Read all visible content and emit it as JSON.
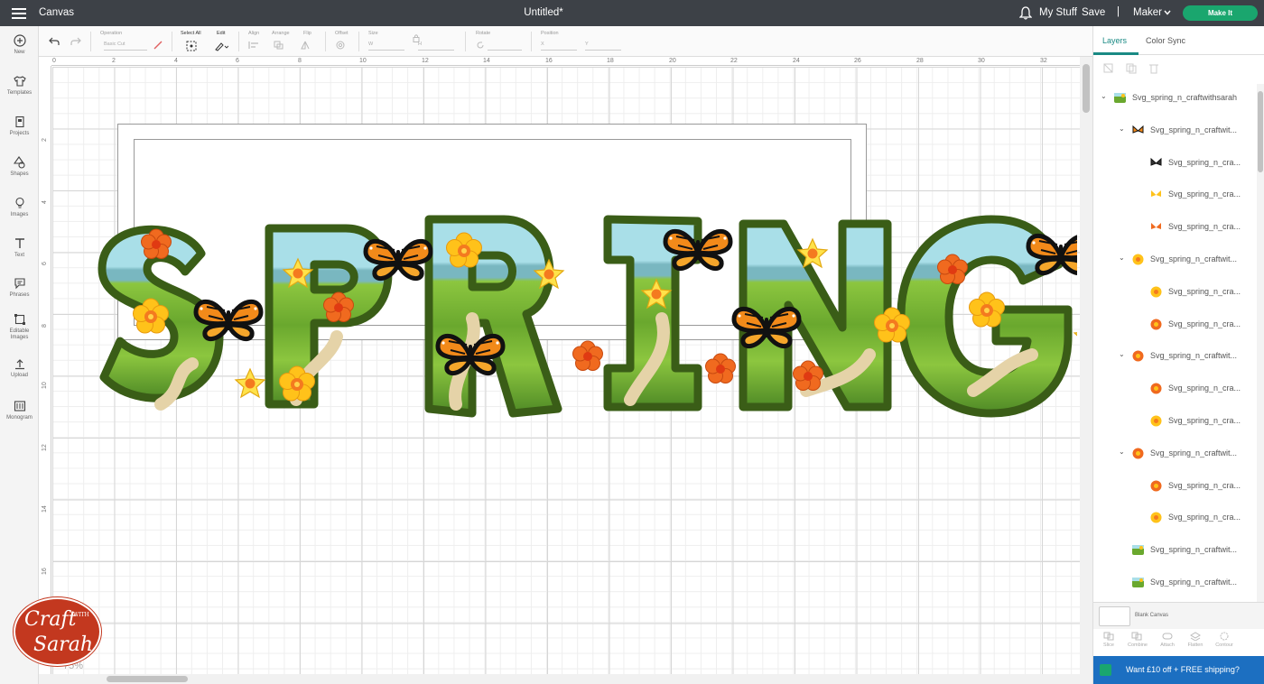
{
  "topbar": {
    "app_title": "Canvas",
    "document_title": "Untitled*",
    "my_stuff": "My Stuff",
    "save": "Save",
    "separator": "|",
    "machine": "Maker",
    "make_it": "Make It",
    "accent_color": "#1aa66e"
  },
  "sidebar": {
    "items": [
      {
        "label": "New",
        "icon": "plus-circle-icon"
      },
      {
        "label": "Templates",
        "icon": "shirt-icon"
      },
      {
        "label": "Projects",
        "icon": "projects-icon"
      },
      {
        "label": "Shapes",
        "icon": "shapes-icon"
      },
      {
        "label": "Images",
        "icon": "lightbulb-icon"
      },
      {
        "label": "Text",
        "icon": "text-icon"
      },
      {
        "label": "Phrases",
        "icon": "speech-bubble-icon"
      },
      {
        "label": "Editable Images",
        "icon": "editable-image-icon"
      },
      {
        "label": "Upload",
        "icon": "upload-icon"
      },
      {
        "label": "Monogram",
        "icon": "monogram-icon"
      }
    ]
  },
  "toolbar": {
    "operation_label": "Operation",
    "operation_value": "Basic Cut",
    "select_all": "Select All",
    "edit": "Edit",
    "align": "Align",
    "arrange": "Arrange",
    "flip": "Flip",
    "offset": "Offset",
    "size": "Size",
    "w": "W",
    "h": "H",
    "rotate": "Rotate",
    "position": "Position",
    "x": "X",
    "y": "Y"
  },
  "canvas": {
    "ruler_top": [
      "0",
      "2",
      "4",
      "6",
      "8",
      "10",
      "12",
      "14",
      "16",
      "18",
      "20",
      "22",
      "24",
      "26",
      "28",
      "30",
      "32"
    ],
    "ruler_left": [
      "2",
      "4",
      "6",
      "8",
      "10",
      "12",
      "14",
      "16"
    ],
    "artwork_letters": [
      "S",
      "P",
      "R",
      "I",
      "N",
      "G"
    ],
    "zoom": "75%"
  },
  "watermark": {
    "line1": "Craft",
    "line2": "WITH",
    "line3": "Sarah"
  },
  "right_panel": {
    "tabs": [
      "Layers",
      "Color Sync"
    ],
    "layers": [
      {
        "name": "Svg_spring_n_craftwithsarah",
        "level": 0,
        "caret": true,
        "thumb": "landscape"
      },
      {
        "name": "Svg_spring_n_craftwit...",
        "level": 1,
        "caret": true,
        "thumb": "butterfly"
      },
      {
        "name": "Svg_spring_n_cra...",
        "level": 2,
        "caret": false,
        "thumb": "butterfly-dark"
      },
      {
        "name": "Svg_spring_n_cra...",
        "level": 2,
        "caret": false,
        "thumb": "butterfly-yellow"
      },
      {
        "name": "Svg_spring_n_cra...",
        "level": 2,
        "caret": false,
        "thumb": "butterfly-orange"
      },
      {
        "name": "Svg_spring_n_craftwit...",
        "level": 1,
        "caret": true,
        "thumb": "flower-yellow"
      },
      {
        "name": "Svg_spring_n_cra...",
        "level": 2,
        "caret": false,
        "thumb": "flower-yellow"
      },
      {
        "name": "Svg_spring_n_cra...",
        "level": 2,
        "caret": false,
        "thumb": "flower-orange"
      },
      {
        "name": "Svg_spring_n_craftwit...",
        "level": 1,
        "caret": true,
        "thumb": "flower-orange"
      },
      {
        "name": "Svg_spring_n_cra...",
        "level": 2,
        "caret": false,
        "thumb": "flower-orange"
      },
      {
        "name": "Svg_spring_n_cra...",
        "level": 2,
        "caret": false,
        "thumb": "flower-yellow"
      },
      {
        "name": "Svg_spring_n_craftwit...",
        "level": 1,
        "caret": true,
        "thumb": "flower-orange"
      },
      {
        "name": "Svg_spring_n_cra...",
        "level": 2,
        "caret": false,
        "thumb": "flower-orange"
      },
      {
        "name": "Svg_spring_n_cra...",
        "level": 2,
        "caret": false,
        "thumb": "flower-yellow"
      },
      {
        "name": "Svg_spring_n_craftwit...",
        "level": 1,
        "caret": false,
        "thumb": "landscape"
      },
      {
        "name": "Svg_spring_n_craftwit...",
        "level": 1,
        "caret": false,
        "thumb": "landscape"
      }
    ],
    "blank_canvas": "Blank Canvas",
    "actions": [
      "Slice",
      "Combine",
      "Attach",
      "Flatten",
      "Contour"
    ],
    "promo": "Want £10 off + FREE shipping?"
  }
}
